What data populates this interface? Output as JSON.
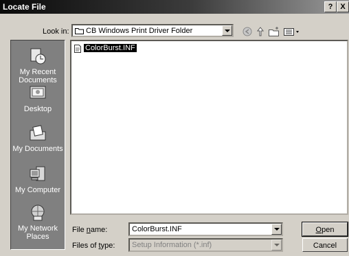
{
  "window": {
    "title": "Locate File",
    "help_label": "?",
    "close_label": "X"
  },
  "look_in": {
    "label": "Look in:",
    "value": "CB Windows Print Driver Folder"
  },
  "toolbar": {
    "icons": [
      "back-icon",
      "up-folder-icon",
      "new-folder-icon",
      "view-menu-icon"
    ]
  },
  "places": [
    {
      "label": "My Recent Documents",
      "icon": "recent-documents-icon"
    },
    {
      "label": "Desktop",
      "icon": "desktop-icon"
    },
    {
      "label": "My Documents",
      "icon": "my-documents-icon"
    },
    {
      "label": "My Computer",
      "icon": "my-computer-icon"
    },
    {
      "label": "My Network Places",
      "icon": "network-places-icon"
    }
  ],
  "files": [
    {
      "name": "ColorBurst.INF",
      "selected": true
    }
  ],
  "file_name": {
    "label": "File name:",
    "value": "ColorBurst.INF"
  },
  "file_type": {
    "label": "Files of type:",
    "value": "Setup Information (*.inf)"
  },
  "buttons": {
    "open": "Open",
    "cancel": "Cancel"
  }
}
